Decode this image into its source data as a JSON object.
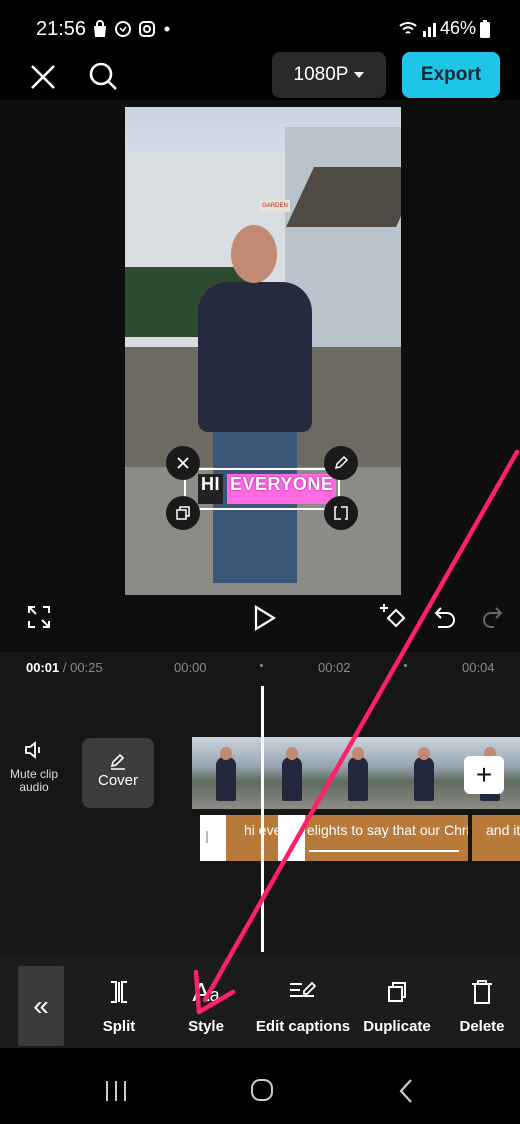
{
  "status_bar": {
    "time": "21:56",
    "left_icons": [
      "shopping-bag-icon",
      "whatsapp-icon",
      "instagram-icon",
      "dot-icon"
    ],
    "battery": "46%",
    "right_icons": [
      "wifi-icon",
      "signal-icon",
      "battery-icon"
    ]
  },
  "top_bar": {
    "resolution": "1080P",
    "export_label": "Export"
  },
  "preview": {
    "caption_word_1": "HI",
    "caption_word_2": "EVERYONE",
    "sign_text": "GARDEN"
  },
  "timeline": {
    "current_time": "00:01",
    "total_time": "/ 00:25",
    "ticks": [
      "00:00",
      "00:02",
      "00:04"
    ],
    "mute_label": "Mute clip audio",
    "cover_label": "Cover",
    "caption_segments": [
      "hi ever",
      "elights to say that our Chri",
      "and it"
    ]
  },
  "toolbar": {
    "collapse_glyph": "«",
    "items": [
      {
        "label": "Split"
      },
      {
        "label": "Style"
      },
      {
        "label": "Edit captions"
      },
      {
        "label": "Duplicate"
      },
      {
        "label": "Delete"
      }
    ]
  },
  "colors": {
    "accent": "#1fc5e6",
    "caption_track": "#b87a3a",
    "caption_highlight": "#ff6be0",
    "annotation_arrow": "#ff1f6b"
  }
}
